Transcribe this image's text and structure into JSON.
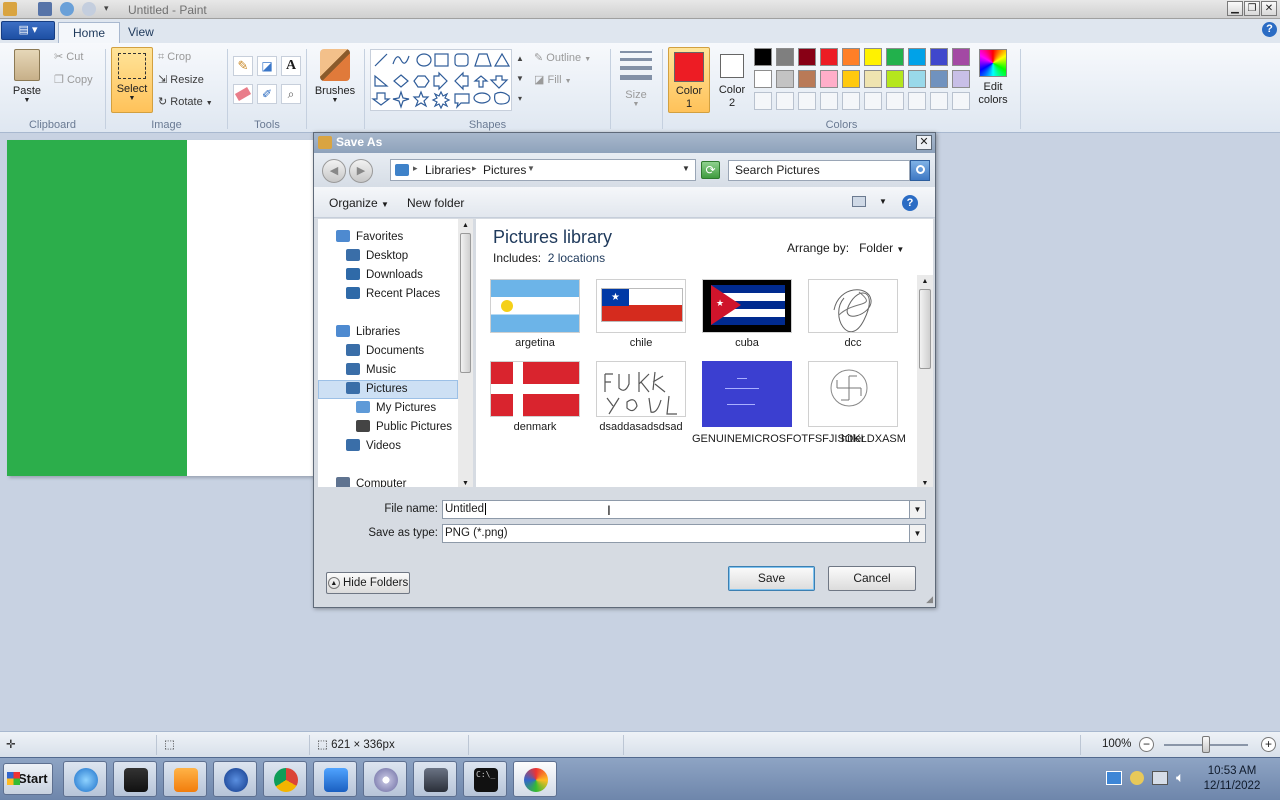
{
  "window": {
    "title": "Untitled - Paint",
    "minimize_glyph": "▁",
    "restore_glyph": "❐",
    "close_glyph": "✕",
    "help_glyph": "?"
  },
  "ribbon": {
    "file_glyph": "▤ ▾",
    "tabs": [
      "Home",
      "View"
    ],
    "clipboard": {
      "paste": "Paste",
      "cut": "Cut",
      "copy": "Copy",
      "group": "Clipboard"
    },
    "image": {
      "select": "Select",
      "crop": "Crop",
      "resize": "Resize",
      "rotate": "Rotate",
      "group": "Image"
    },
    "tools": {
      "group": "Tools"
    },
    "brushes": {
      "label": "Brushes"
    },
    "shapes": {
      "group": "Shapes",
      "outline": "Outline",
      "fill": "Fill"
    },
    "size": {
      "label": "Size"
    },
    "colors": {
      "color1": "Color 1",
      "color2": "Color 2",
      "edit": "Edit colors",
      "group": "Colors",
      "color1_value": "#ed1c24",
      "color2_value": "#ffffff",
      "palette_row1": [
        "#000000",
        "#7f7f7f",
        "#880015",
        "#ed1c24",
        "#ff7f27",
        "#fff200",
        "#22b14c",
        "#00a2e8",
        "#3f48cc",
        "#a349a4"
      ],
      "palette_row2": [
        "#ffffff",
        "#c3c3c3",
        "#b97a57",
        "#ffaec9",
        "#ffc90e",
        "#efe4b0",
        "#b5e61d",
        "#99d9ea",
        "#7092be",
        "#c8bfe7"
      ]
    }
  },
  "canvas": {
    "stripe_color": "#2cae4b"
  },
  "dialog": {
    "title": "Save As",
    "breadcrumb": [
      "Libraries",
      "Pictures"
    ],
    "search_placeholder": "Search Pictures",
    "toolbar": {
      "organize": "Organize",
      "new_folder": "New folder"
    },
    "nav": {
      "favorites": "Favorites",
      "desktop": "Desktop",
      "downloads": "Downloads",
      "recent": "Recent Places",
      "libraries": "Libraries",
      "documents": "Documents",
      "music": "Music",
      "pictures": "Pictures",
      "my_pictures": "My Pictures",
      "public_pictures": "Public Pictures",
      "videos": "Videos",
      "computer": "Computer"
    },
    "library": {
      "title": "Pictures library",
      "includes_label": "Includes:",
      "locations": "2 locations",
      "arrange_label": "Arrange by:",
      "arrange_value": "Folder"
    },
    "files": [
      {
        "name": "argetina"
      },
      {
        "name": "chile"
      },
      {
        "name": "cuba"
      },
      {
        "name": "dcc"
      },
      {
        "name": "denmark"
      },
      {
        "name": "dsaddasadsdsad"
      },
      {
        "name": "GENUINEMICROSFOTFSFJISOKLDXASM"
      },
      {
        "name": "hitler"
      }
    ],
    "file_name_label": "File name:",
    "file_name_value": "Untitled",
    "save_type_label": "Save as type:",
    "save_type_value": "PNG (*.png)",
    "hide_folders": "Hide Folders",
    "save": "Save",
    "cancel": "Cancel"
  },
  "status": {
    "dimensions": "621 × 336px",
    "zoom": "100%"
  },
  "taskbar": {
    "start": "Start",
    "time": "10:53 AM",
    "date": "12/11/2022"
  }
}
